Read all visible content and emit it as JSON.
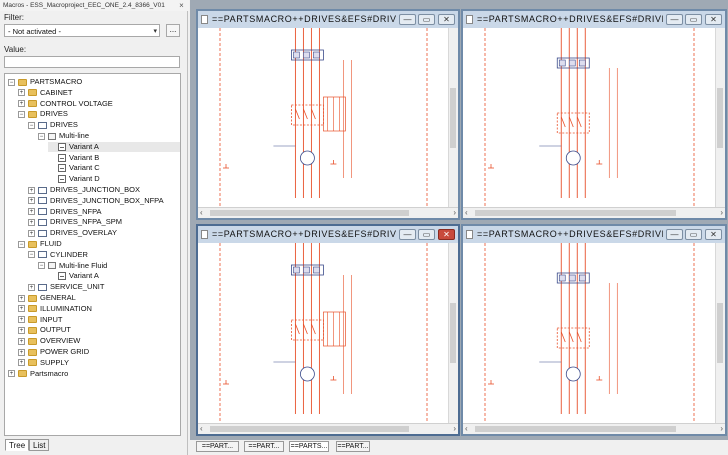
{
  "panel": {
    "title": "Macros - ESS_Macroproject_EEC_ONE_2.4_8366_V01",
    "close": "×"
  },
  "filter": {
    "label": "Filter:",
    "selected": "- Not activated -",
    "browse": "..."
  },
  "value": {
    "label": "Value:",
    "text": ""
  },
  "tree": [
    {
      "label": "PARTSMACRO",
      "type": "folder",
      "expander": "−",
      "indent": 0,
      "selected": false
    },
    {
      "label": "CABINET",
      "type": "folder",
      "expander": "+",
      "indent": 1,
      "selected": false
    },
    {
      "label": "CONTROL VOLTAGE",
      "type": "folder",
      "expander": "+",
      "indent": 1,
      "selected": false
    },
    {
      "label": "DRIVES",
      "type": "folder",
      "expander": "−",
      "indent": 1,
      "selected": false
    },
    {
      "label": "DRIVES",
      "type": "macro",
      "expander": "−",
      "indent": 2,
      "selected": false
    },
    {
      "label": "Multi-line",
      "type": "sheet",
      "expander": "−",
      "indent": 3,
      "selected": false
    },
    {
      "label": "Variant A",
      "type": "variant",
      "expander": "",
      "indent": 4,
      "selected": true
    },
    {
      "label": "Variant B",
      "type": "variant",
      "expander": "",
      "indent": 4,
      "selected": false
    },
    {
      "label": "Variant C",
      "type": "variant",
      "expander": "",
      "indent": 4,
      "selected": false
    },
    {
      "label": "Variant D",
      "type": "variant",
      "expander": "",
      "indent": 4,
      "selected": false
    },
    {
      "label": "DRIVES_JUNCTION_BOX",
      "type": "macro",
      "expander": "+",
      "indent": 2,
      "selected": false
    },
    {
      "label": "DRIVES_JUNCTION_BOX_NFPA",
      "type": "macro",
      "expander": "+",
      "indent": 2,
      "selected": false
    },
    {
      "label": "DRIVES_NFPA",
      "type": "macro",
      "expander": "+",
      "indent": 2,
      "selected": false
    },
    {
      "label": "DRIVES_NFPA_SPM",
      "type": "macro",
      "expander": "+",
      "indent": 2,
      "selected": false
    },
    {
      "label": "DRIVES_OVERLAY",
      "type": "macro",
      "expander": "+",
      "indent": 2,
      "selected": false
    },
    {
      "label": "FLUID",
      "type": "folder",
      "expander": "−",
      "indent": 1,
      "selected": false
    },
    {
      "label": "CYLINDER",
      "type": "macro",
      "expander": "−",
      "indent": 2,
      "selected": false
    },
    {
      "label": "Multi-line Fluid",
      "type": "sheet",
      "expander": "−",
      "indent": 3,
      "selected": false
    },
    {
      "label": "Variant A",
      "type": "variant",
      "expander": "",
      "indent": 4,
      "selected": false
    },
    {
      "label": "SERVICE_UNIT",
      "type": "macro",
      "expander": "+",
      "indent": 2,
      "selected": false
    },
    {
      "label": "GENERAL",
      "type": "folder",
      "expander": "+",
      "indent": 1,
      "selected": false
    },
    {
      "label": "ILLUMINATION",
      "type": "folder",
      "expander": "+",
      "indent": 1,
      "selected": false
    },
    {
      "label": "INPUT",
      "type": "folder",
      "expander": "+",
      "indent": 1,
      "selected": false
    },
    {
      "label": "OUTPUT",
      "type": "folder",
      "expander": "+",
      "indent": 1,
      "selected": false
    },
    {
      "label": "OVERVIEW",
      "type": "folder",
      "expander": "+",
      "indent": 1,
      "selected": false
    },
    {
      "label": "POWER GRID",
      "type": "folder",
      "expander": "+",
      "indent": 1,
      "selected": false
    },
    {
      "label": "SUPPLY",
      "type": "folder",
      "expander": "+",
      "indent": 1,
      "selected": false
    },
    {
      "label": "Partsmacro",
      "type": "folder",
      "expander": "+",
      "indent": 0,
      "selected": false
    }
  ],
  "bottom_tabs": [
    "Tree",
    "List"
  ],
  "windows": [
    {
      "title": "==PARTSMACRO++DRIVES&EFS#DRIVES",
      "active": false
    },
    {
      "title": "==PARTSMACRO++DRIVES&EFS#DRIVES",
      "active": false
    },
    {
      "title": "==PARTSMACRO++DRIVES&EFS#DRIVES",
      "active": true
    },
    {
      "title": "==PARTSMACRO++DRIVES&EFS#DRIVES",
      "active": false
    }
  ],
  "window_buttons": {
    "minimize": "—",
    "restore": "▭",
    "close": "✕"
  },
  "doc_tabs": [
    "==PART...",
    "==PART...",
    "==PARTS...",
    "==PART..."
  ],
  "colors": {
    "schematic": "#e8502a",
    "window_border": "#6f8aa8",
    "title_bar": "#cad8e8",
    "doc_area": "#9fa9b4"
  }
}
